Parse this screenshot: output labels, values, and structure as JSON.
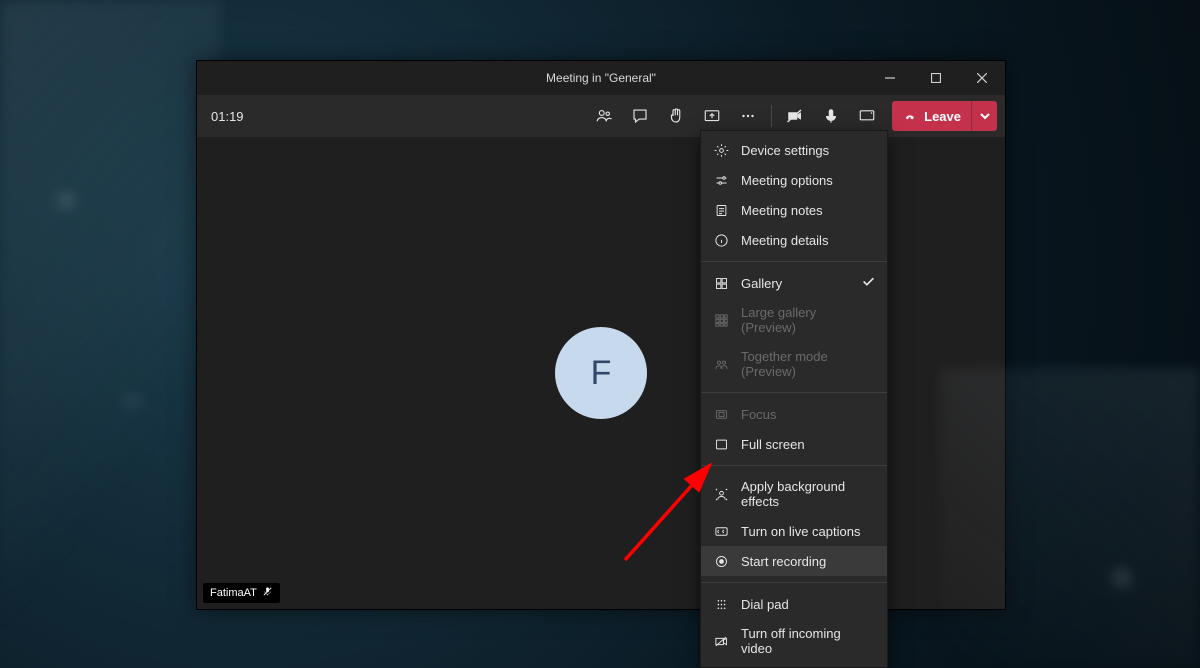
{
  "window": {
    "title": "Meeting in \"General\""
  },
  "toolbar": {
    "timer": "01:19",
    "leave_label": "Leave"
  },
  "avatar": {
    "initial": "F"
  },
  "participant": {
    "name": "FatimaAT"
  },
  "menu": {
    "device_settings": "Device settings",
    "meeting_options": "Meeting options",
    "meeting_notes": "Meeting notes",
    "meeting_details": "Meeting details",
    "gallery": "Gallery",
    "large_gallery": "Large gallery (Preview)",
    "together_mode": "Together mode (Preview)",
    "focus": "Focus",
    "full_screen": "Full screen",
    "apply_bg": "Apply background effects",
    "live_captions": "Turn on live captions",
    "start_recording": "Start recording",
    "dial_pad": "Dial pad",
    "turn_off_incoming": "Turn off incoming video"
  },
  "annotation": {
    "target": "start_recording"
  }
}
